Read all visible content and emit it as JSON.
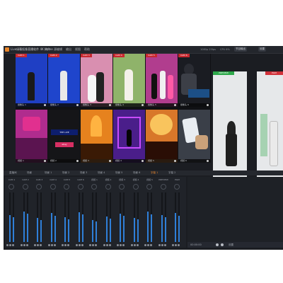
{
  "app": {
    "title": "Live绿幕抠像直播软件 4K Home",
    "menu": [
      "文件",
      "源编辑",
      "输出",
      "视图",
      "帮助"
    ],
    "stats": [
      "1080p 25fps",
      "CPU 6%"
    ],
    "buttons": [
      "节目输出",
      "设置"
    ]
  },
  "grid": {
    "cells": [
      {
        "tag": "CAM 1",
        "caption": "摄像头 1",
        "bg": "#1f3fc4"
      },
      {
        "tag": "CAM 2",
        "caption": "摄像头 2",
        "bg": "#1f45cc"
      },
      {
        "tag": "CAM 3",
        "caption": "摄像头 3",
        "bg": "#d98fb0"
      },
      {
        "tag": "CAM 4",
        "caption": "摄像头 4",
        "bg": "#8fb36a"
      },
      {
        "tag": "CAM 5",
        "caption": "摄像头 5",
        "bg": "#b13d8e"
      },
      {
        "tag": "CAM 6",
        "caption": "摄像头 6",
        "bg": "#1a1c22"
      },
      {
        "tag": "",
        "caption": "视频 1",
        "bg": "#b02c8e"
      },
      {
        "tag": "",
        "caption": "视频 2",
        "bg": "#151518"
      },
      {
        "tag": "",
        "caption": "视频 3",
        "bg": "#e6821e"
      },
      {
        "tag": "",
        "caption": "视频 4",
        "bg": "#4a1e8a"
      },
      {
        "tag": "",
        "caption": "视频 5",
        "bg": "#d8772a"
      },
      {
        "tag": "",
        "caption": "视频 6",
        "bg": "#3a3f48"
      }
    ],
    "overlay_text": [
      "THE LIVE",
      "ebay"
    ]
  },
  "monitors": {
    "preview_label": "PREVIEW",
    "program_label": "PGM"
  },
  "scenebar": {
    "items": [
      "直播间",
      "场景",
      "场景 1",
      "场景 2",
      "场景 3",
      "场景 4",
      "场景 5",
      "场景 6",
      "字幕 1",
      "字幕 2"
    ],
    "active_index": 8
  },
  "mixer": {
    "channels": [
      {
        "name": "CAM 1",
        "level": 0.55
      },
      {
        "name": "CAM 2",
        "level": 0.62
      },
      {
        "name": "CAM 3",
        "level": 0.48
      },
      {
        "name": "CAM 4",
        "level": 0.58
      },
      {
        "name": "CAM 5",
        "level": 0.5
      },
      {
        "name": "CAM 6",
        "level": 0.6
      },
      {
        "name": "视频 1",
        "level": 0.45
      },
      {
        "name": "视频 2",
        "level": 0.52
      },
      {
        "name": "视频 3",
        "level": 0.57
      },
      {
        "name": "视频 4",
        "level": 0.49
      },
      {
        "name": "视频 5",
        "level": 0.61
      },
      {
        "name": "PREVIEW",
        "level": 0.54
      },
      {
        "name": "PGM",
        "level": 0.58
      }
    ],
    "footer_left": "00:00:00",
    "footer_right": "设置"
  },
  "colors": {
    "accent": "#e8862c",
    "preview": "#2da84a",
    "program": "#d1323a",
    "meter": "#2f7fd8"
  }
}
